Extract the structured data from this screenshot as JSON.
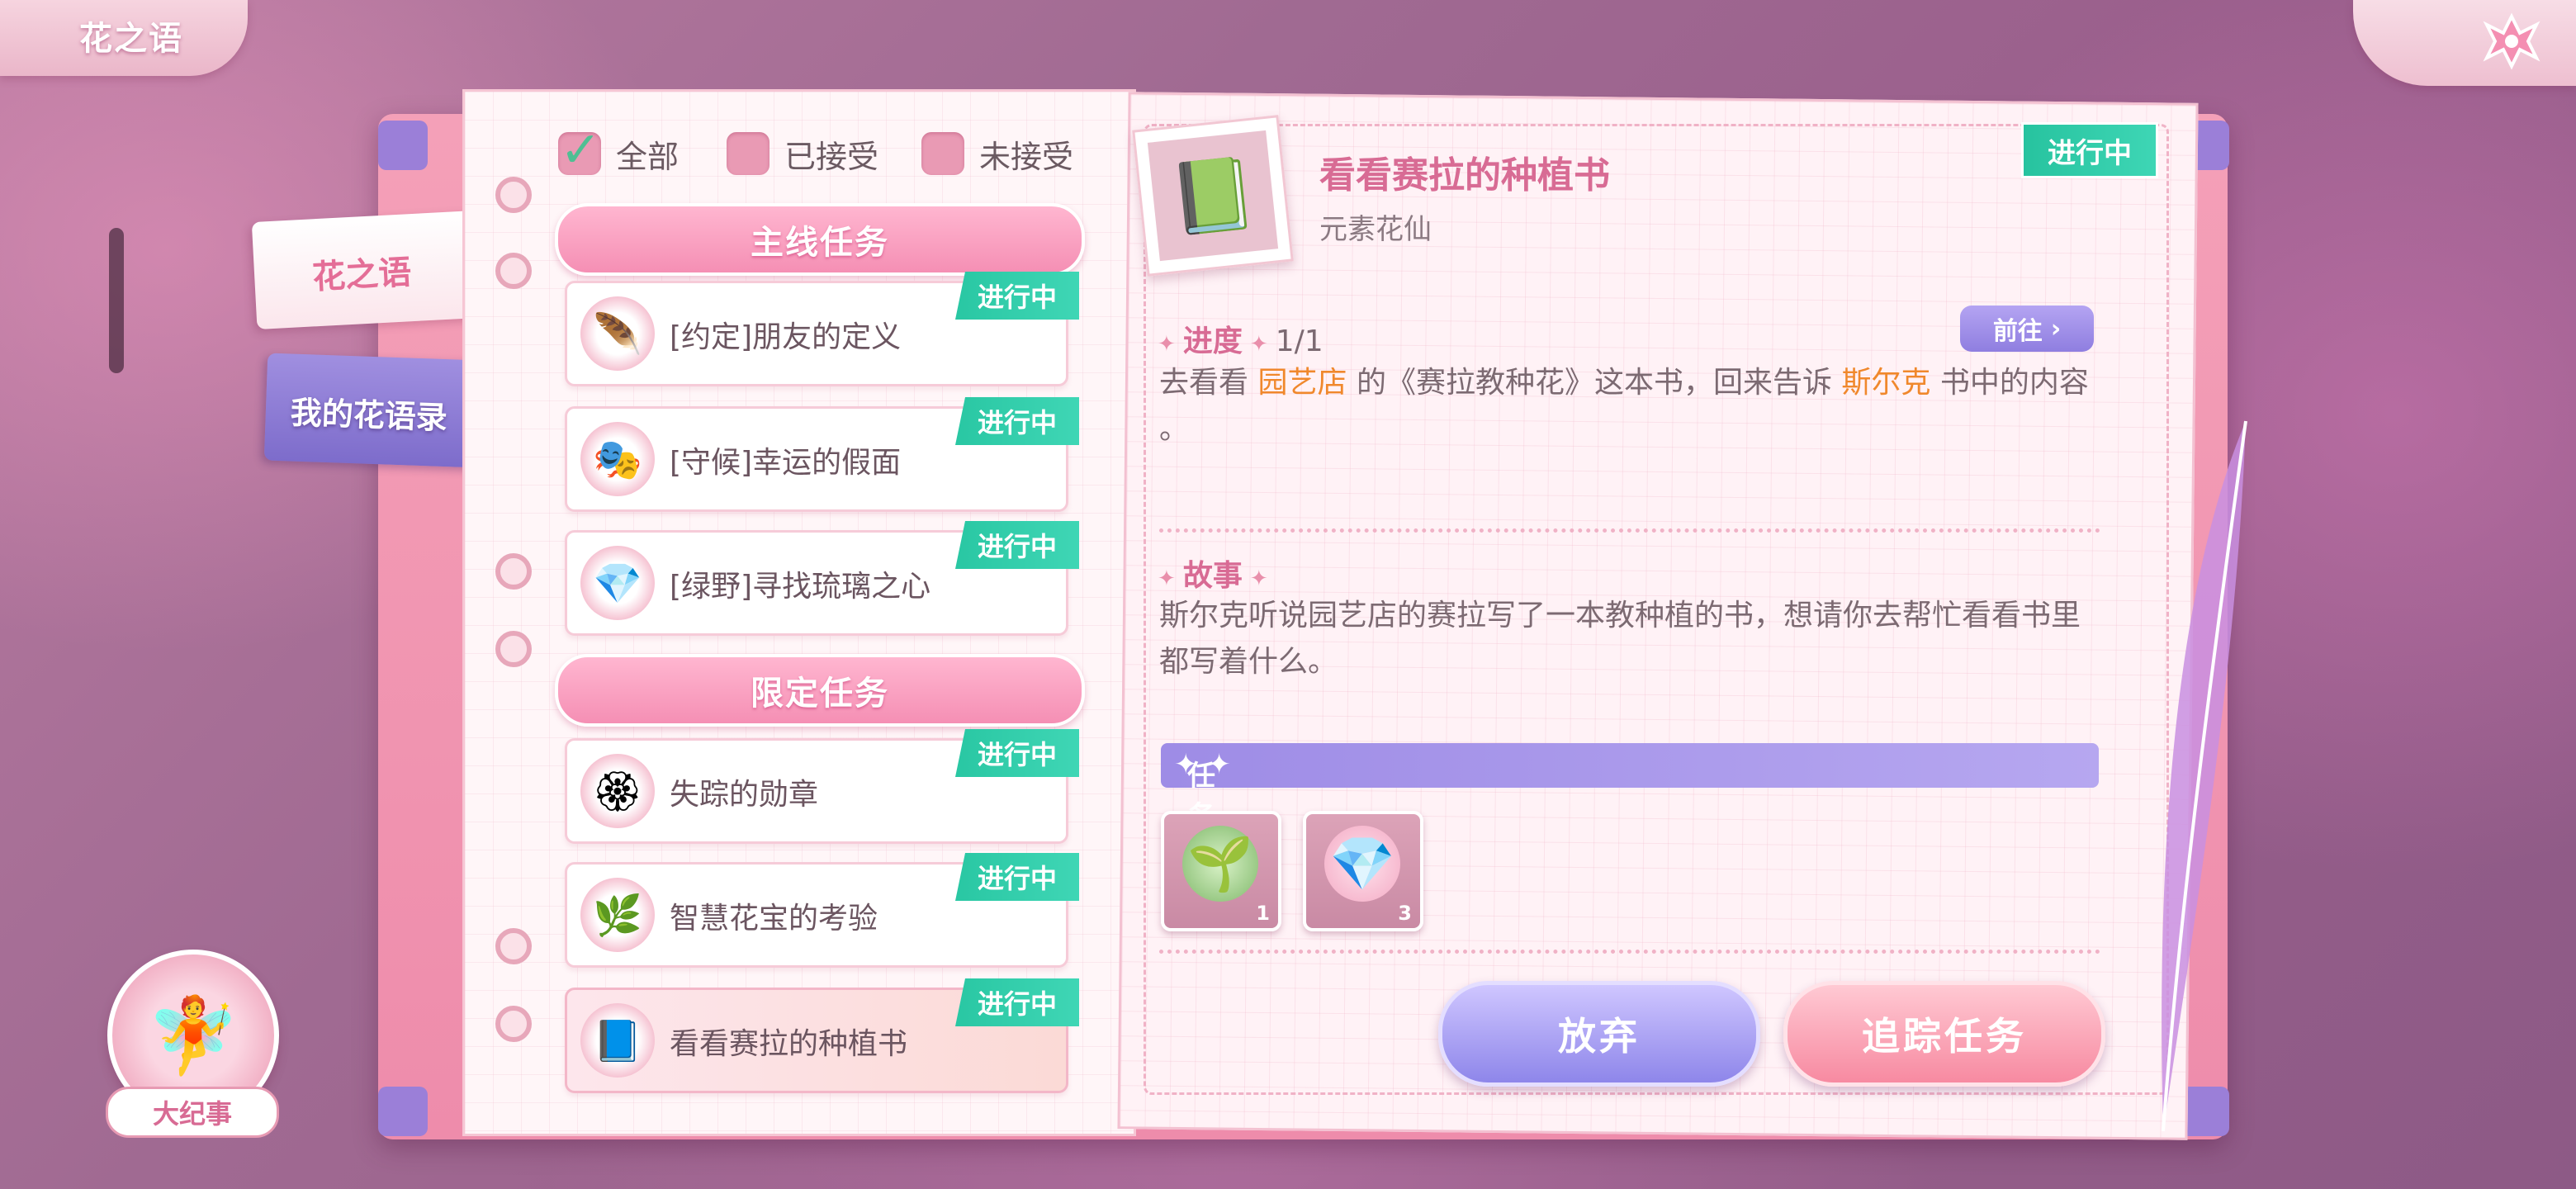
{
  "header": {
    "title": "花之语"
  },
  "tabs": [
    {
      "label": "花之语",
      "active": true
    },
    {
      "label": "我的花语录",
      "active": false
    }
  ],
  "filters": [
    {
      "label": "全部",
      "checked": true
    },
    {
      "label": "已接受",
      "checked": false
    },
    {
      "label": "未接受",
      "checked": false
    }
  ],
  "sections": {
    "main": "主线任务",
    "limited": "限定任务"
  },
  "quests": [
    {
      "name": "[约定]朋友的定义",
      "status": "进行中",
      "icon": "feather-icon",
      "section": "main"
    },
    {
      "name": "[守候]幸运的假面",
      "status": "进行中",
      "icon": "mask-icon",
      "section": "main"
    },
    {
      "name": "[绿野]寻找琉璃之心",
      "status": "进行中",
      "icon": "crystal-icon",
      "section": "main"
    },
    {
      "name": "失踪的勋章",
      "status": "进行中",
      "icon": "medal-icon",
      "section": "limited"
    },
    {
      "name": "智慧花宝的考验",
      "status": "进行中",
      "icon": "flower-sprite-icon",
      "section": "limited"
    },
    {
      "name": "看看赛拉的种植书",
      "status": "进行中",
      "icon": "book-icon",
      "section": "limited",
      "selected": true
    }
  ],
  "detail": {
    "title": "看看赛拉的种植书",
    "subtitle": "元素花仙",
    "status": "进行中",
    "progress_label": "进度",
    "progress_value": "1/1",
    "goto_label": "前往",
    "desc_part1": "去看看",
    "desc_place": "园艺店",
    "desc_part2": "的《赛拉教种花》这本书，回来告诉",
    "desc_npc": "斯尔克",
    "desc_part3": "书中的内容",
    "desc_end": "。",
    "story_label": "故事",
    "story_text": "斯尔克听说园艺店的赛拉写了一本教种植的书，想请你去帮忙看看书里都写着什么。",
    "reward_label": "任务奖励",
    "rewards": [
      {
        "icon": "seed-icon",
        "count": "1"
      },
      {
        "icon": "gem-icon",
        "count": "3"
      }
    ]
  },
  "buttons": {
    "abandon": "放弃",
    "track": "追踪任务"
  },
  "chronicle": {
    "label": "大纪事"
  },
  "colors": {
    "accent_pink": "#d86b94",
    "status_green": "#29c7a3",
    "highlight_orange": "#f0882c",
    "button_purple": "#8e86ea",
    "button_pink": "#f78aa1"
  }
}
